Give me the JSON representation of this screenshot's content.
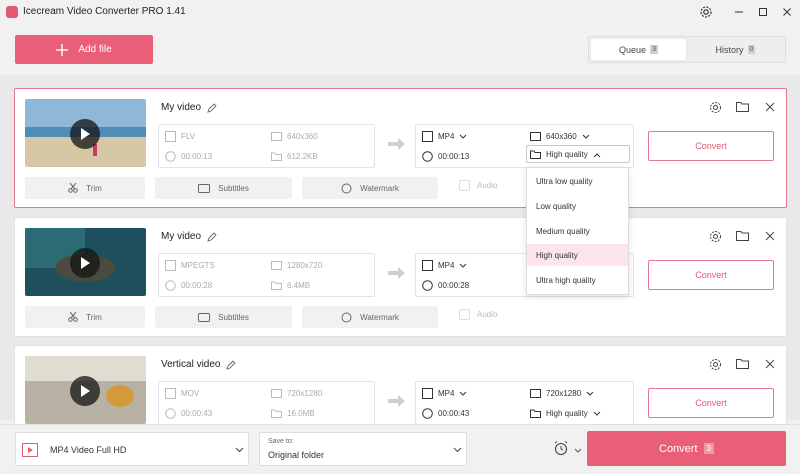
{
  "app": {
    "title": "Icecream Video Converter PRO 1.41"
  },
  "toolbar": {
    "add_file_label": "Add file"
  },
  "tabs": [
    {
      "label": "Queue",
      "count": "3"
    },
    {
      "label": "History",
      "count": "0"
    }
  ],
  "videos": [
    {
      "name": "My video",
      "source": {
        "format": "FLV",
        "resolution": "640x360",
        "duration": "00:00:13",
        "size": "612.2KB"
      },
      "output": {
        "format": "MP4",
        "resolution": "640x360",
        "duration": "00:00:13",
        "quality": "High quality"
      },
      "convert_label": "Convert",
      "tools": {
        "trim": "Trim",
        "subtitles": "Subtitles",
        "watermark": "Watermark",
        "audio": "Audio"
      }
    },
    {
      "name": "My video",
      "source": {
        "format": "MPEGTS",
        "resolution": "1280x720",
        "duration": "00:00:28",
        "size": "6.4MB"
      },
      "output": {
        "format": "MP4",
        "resolution": "",
        "duration": "00:00:28",
        "quality": ""
      },
      "convert_label": "Convert",
      "tools": {
        "trim": "Trim",
        "subtitles": "Subtitles",
        "watermark": "Watermark",
        "audio": "Audio"
      }
    },
    {
      "name": "Vertical video",
      "source": {
        "format": "MOV",
        "resolution": "720x1280",
        "duration": "00:00:43",
        "size": "16.0MB"
      },
      "output": {
        "format": "MP4",
        "resolution": "720x1280",
        "duration": "00:00:43",
        "quality": "High quality"
      },
      "convert_label": "Convert"
    }
  ],
  "quality_menu": {
    "options": [
      "Ultra low quality",
      "Low quality",
      "Medium quality",
      "High quality",
      "Ultra high quality"
    ],
    "selected": "High quality"
  },
  "bottom": {
    "format_preset": "MP4 Video Full HD",
    "save_to_label": "Save to:",
    "save_to_value": "Original folder",
    "convert_all_label": "Convert",
    "convert_all_count": "3"
  },
  "colors": {
    "accent": "#e95f78",
    "accent_border": "#e6798c",
    "selected_row": "#fbe5ea"
  }
}
